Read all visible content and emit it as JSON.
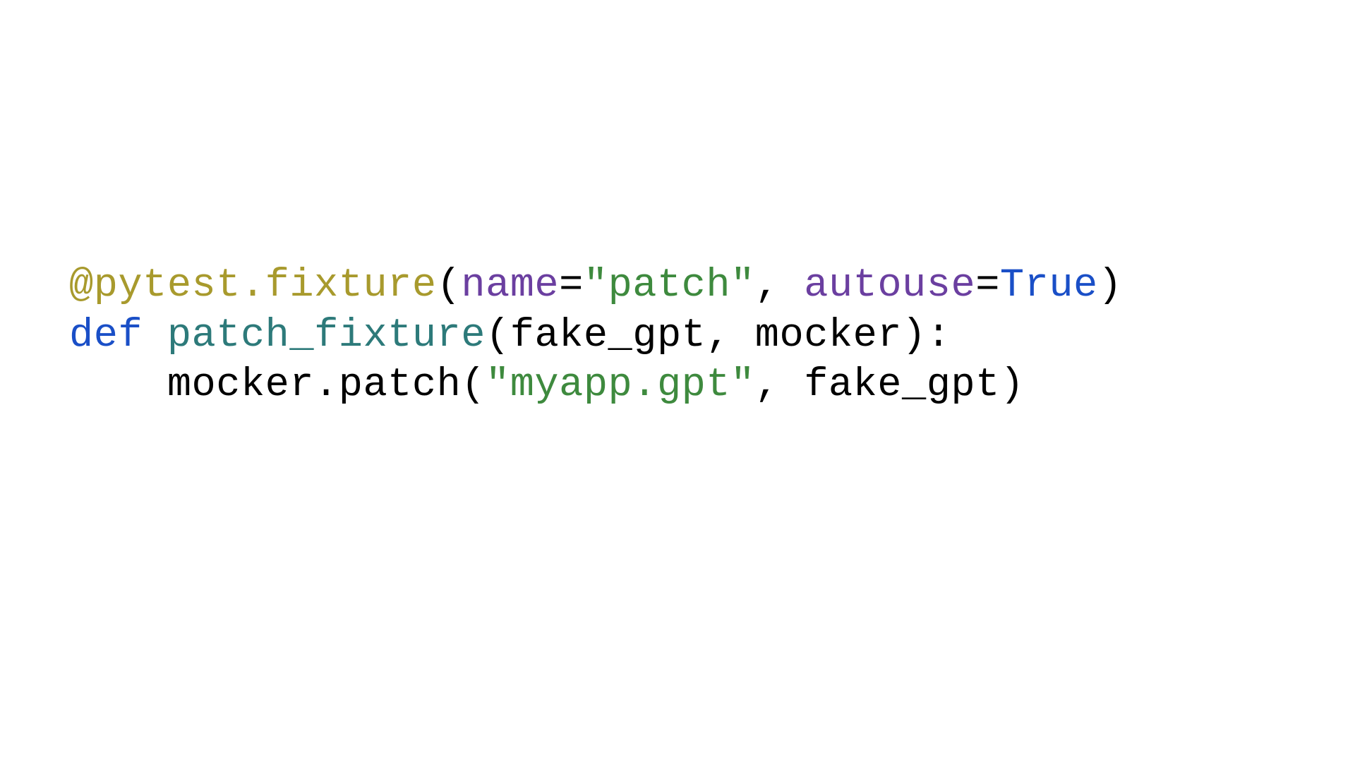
{
  "code": {
    "line1": {
      "decorator": "@pytest.fixture",
      "open": "(",
      "kwarg1": "name",
      "eq1": "=",
      "str1": "\"patch\"",
      "comma1": ", ",
      "kwarg2": "autouse",
      "eq2": "=",
      "true": "True",
      "close": ")"
    },
    "line2": {
      "def": "def",
      "space": " ",
      "fname": "patch_fixture",
      "params": "(fake_gpt, mocker):"
    },
    "line3": {
      "indent": "    ",
      "call1": "mocker.patch(",
      "str": "\"myapp.gpt\"",
      "rest": ", fake_gpt)"
    }
  }
}
